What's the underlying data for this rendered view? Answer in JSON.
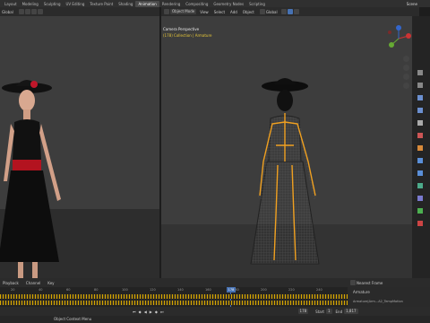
{
  "topbar": {
    "workspaces": [
      "Layout",
      "Modeling",
      "Sculpting",
      "UV Editing",
      "Texture Paint",
      "Shading",
      "Animation",
      "Rendering",
      "Compositing",
      "Geometry Nodes",
      "Scripting"
    ],
    "active": "Animation",
    "scene_label": "Scene"
  },
  "left_viewport": {
    "header": {
      "mode": "Global",
      "options": "Options"
    }
  },
  "right_viewport": {
    "header": {
      "mode": "Object Mode",
      "menus": [
        "View",
        "Select",
        "Add",
        "Object"
      ],
      "orientation": "Global",
      "options": "Options"
    },
    "overlay": {
      "title": "Camera Perspective",
      "subtitle": "(178) Collection | Armature"
    }
  },
  "timeline": {
    "menus": [
      "Playback",
      "Channel",
      "Key"
    ],
    "ticks": [
      "20",
      "40",
      "60",
      "80",
      "100",
      "120",
      "140",
      "160",
      "180",
      "200",
      "220",
      "240"
    ],
    "current_frame": "178",
    "start_label": "Start",
    "start_value": "1",
    "end_label": "End",
    "end_value": "1,817",
    "snap": "Nearest Frame",
    "channel_group": "Armature",
    "channel_action": "Armature|Arm…A2_TempMotion"
  },
  "statusbar": {
    "hint": "Object Context Menu"
  },
  "colors": {
    "accent": "#4772b3",
    "keyframe": "#d8a800",
    "bg": "#3d3d3d"
  }
}
